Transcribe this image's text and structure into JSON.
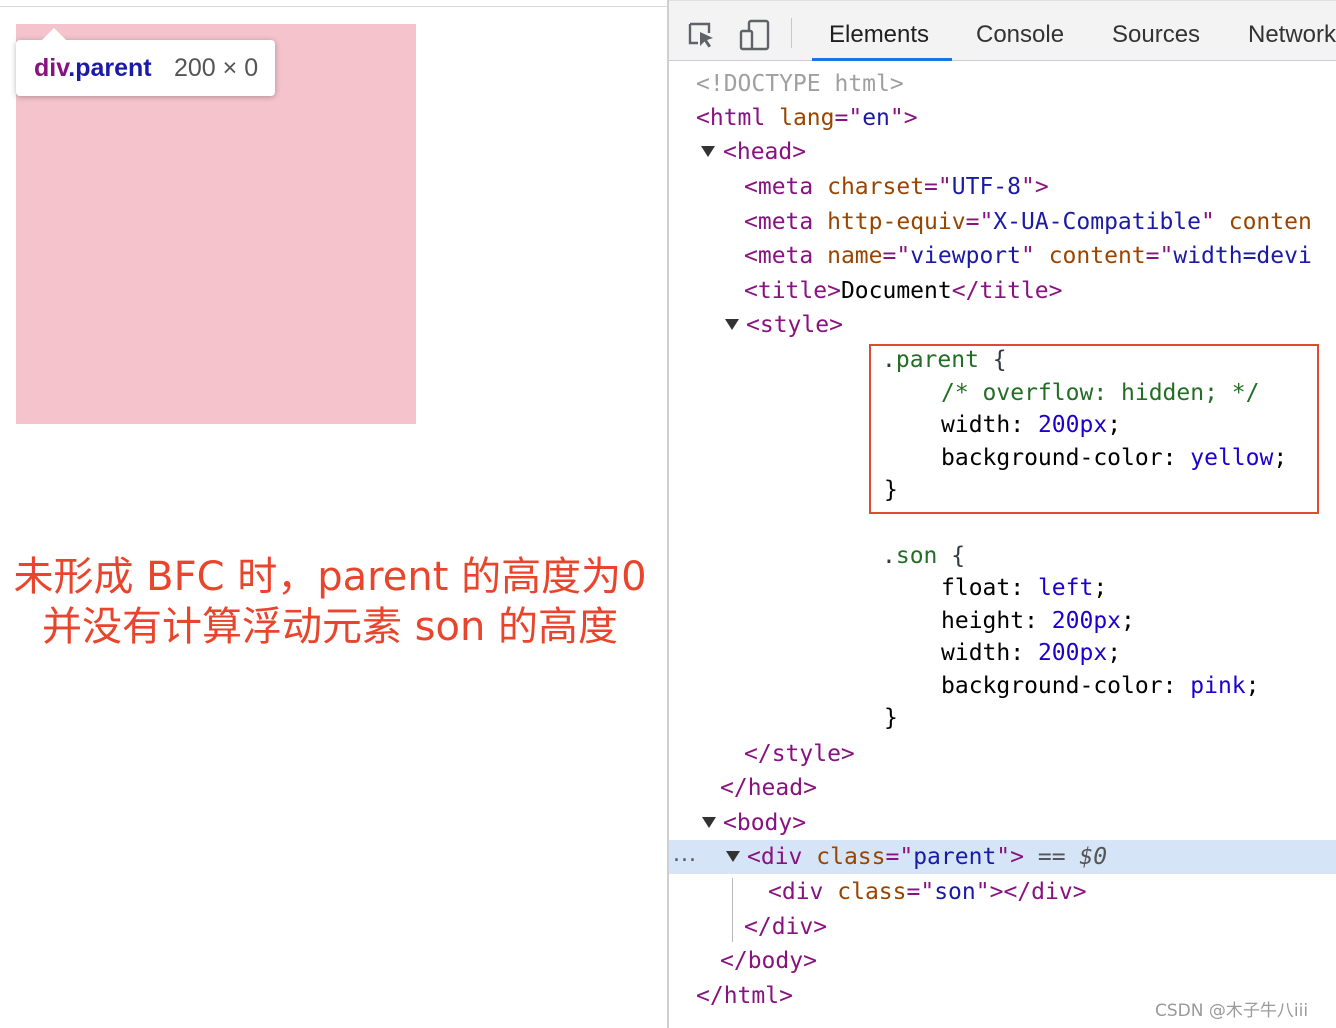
{
  "preview": {
    "tooltip": {
      "tag": "div",
      "class_name": ".parent",
      "dimensions": "200 × 0"
    },
    "annotation": {
      "line1": "未形成 BFC 时，parent 的高度为0",
      "line2": "并没有计算浮动元素 son 的高度"
    },
    "colors": {
      "son_background": "#f4c3cc",
      "annotation": "#e8452c"
    }
  },
  "devtools": {
    "toolbar": {
      "icons": [
        "inspect-element-icon",
        "device-toolbar-icon"
      ],
      "tabs": [
        {
          "label": "Elements",
          "active": true
        },
        {
          "label": "Console",
          "active": false
        },
        {
          "label": "Sources",
          "active": false
        },
        {
          "label": "Network",
          "active": false
        }
      ]
    },
    "dom": {
      "doctype": "<!DOCTYPE html>",
      "html_open": {
        "tag": "<html",
        "attr": "lang",
        "eq": "=\"",
        "value": "en",
        "close": "\">"
      },
      "head_open": "<head>",
      "meta1": {
        "tag": "<meta",
        "attr": "charset",
        "value": "UTF-8"
      },
      "meta2": {
        "tag": "<meta",
        "attr": "http-equiv",
        "value": "X-UA-Compatible",
        "attr2": "conten"
      },
      "meta3": {
        "tag": "<meta",
        "attr": "name",
        "value": "viewport",
        "attr2": "content",
        "value2": "width=devi"
      },
      "title": {
        "open": "<title>",
        "text": "Document",
        "close": "</title>"
      },
      "style_open": "<style>",
      "css_parent": {
        "selector_dot": ".",
        "selector": "parent",
        "open_brace": " {",
        "comment": "/* overflow: hidden; */",
        "decls": [
          {
            "prop": "width",
            "value": "200px"
          },
          {
            "prop": "background-color",
            "value": "yellow"
          }
        ],
        "close_brace": "}"
      },
      "css_son": {
        "selector_dot": ".",
        "selector": "son",
        "open_brace": " {",
        "decls": [
          {
            "prop": "float",
            "value": "left"
          },
          {
            "prop": "height",
            "value": "200px"
          },
          {
            "prop": "width",
            "value": "200px"
          },
          {
            "prop": "background-color",
            "value": "pink"
          }
        ],
        "close_brace": "}"
      },
      "style_close": "</style>",
      "head_close": "</head>",
      "body_open": "<body>",
      "parent_div": {
        "tag": "<div",
        "attr": "class",
        "value": "parent",
        "suffix": " == ",
        "ref": "$0"
      },
      "son_div": {
        "tag": "<div",
        "attr": "class",
        "value": "son",
        "close": "></div>"
      },
      "div_close": "</div>",
      "body_close": "</body>",
      "html_close": "</html>",
      "selected_row_ellipsis": "..."
    },
    "highlight_color": "#e04a33",
    "selected_row_color": "#d6e4f7"
  },
  "watermark": "CSDN @木子牛八iii"
}
